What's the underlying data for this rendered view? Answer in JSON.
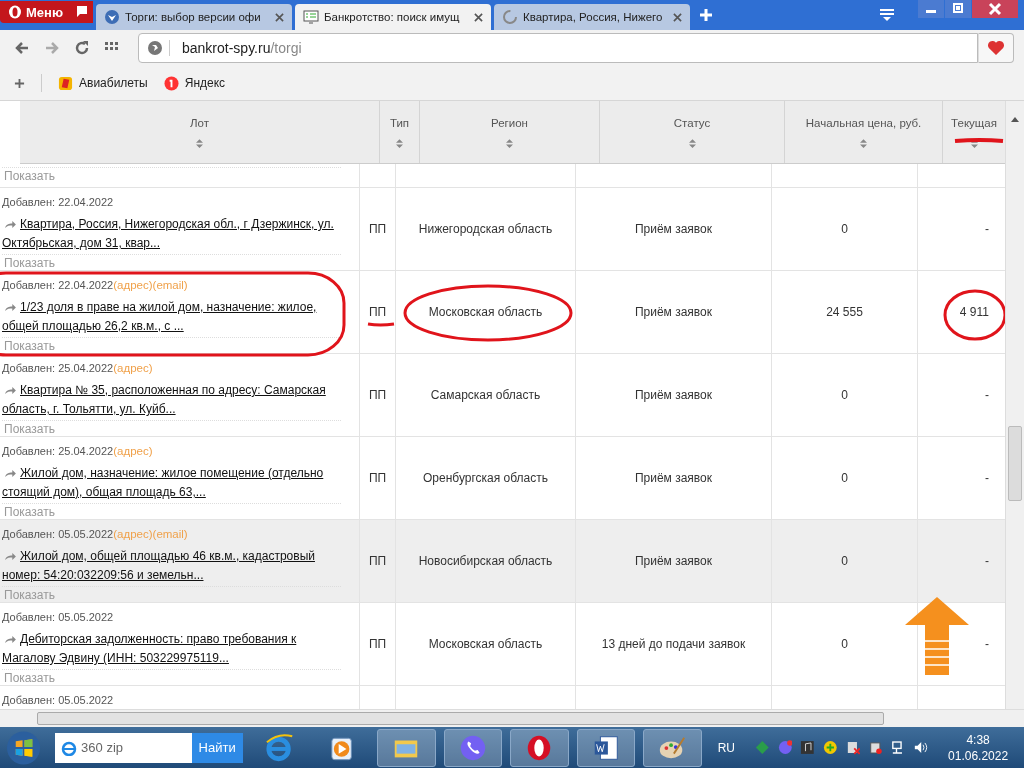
{
  "browser": {
    "menu_label": "Меню",
    "tabs": [
      {
        "title": "Торги: выбор версии офи",
        "selected": false,
        "loading": false
      },
      {
        "title": "Банкротство: поиск имущ",
        "selected": true,
        "loading": false
      },
      {
        "title": "Квартира, Россия, Нижего",
        "selected": false,
        "loading": true
      }
    ],
    "address": {
      "host": "bankrot-spy.ru",
      "path": "/torgi"
    },
    "bookmarks": [
      "Авиабилеты",
      "Яндекс"
    ]
  },
  "table": {
    "columns": [
      "Лот",
      "Тип",
      "Регион",
      "Статус",
      "Начальная цена, руб.",
      "Текущая"
    ],
    "partial_top_row": {
      "show_label": "Показать"
    },
    "rows": [
      {
        "added": "Добавлен: 22.04.2022",
        "tags": [],
        "title": "Квартира, Россия, Нижегородская обл., г Дзержинск, ул. Октябрьская, дом 31, квар...",
        "show_label": "Показать",
        "type": "ПП",
        "region": "Нижегородская область",
        "status": "Приём заявок",
        "start_price": "0",
        "current_price": "-",
        "hovered": false
      },
      {
        "added": "Добавлен: 22.04.2022",
        "tags": [
          "(адрес)",
          "(email)"
        ],
        "title": "1/23 доля в праве на жилой дом, назначение: жилое, общей площадью 26,2 кв.м., с ...",
        "show_label": "Показать",
        "type": "ПП",
        "region": "Московская область",
        "status": "Приём заявок",
        "start_price": "24 555",
        "current_price": "4 911",
        "hovered": false
      },
      {
        "added": "Добавлен: 25.04.2022",
        "tags": [
          "(адрес)"
        ],
        "title": "Квартира № 35, расположенная по адресу: Самарская область, г. Тольятти, ул. Куйб...",
        "show_label": "Показать",
        "type": "ПП",
        "region": "Самарская область",
        "status": "Приём заявок",
        "start_price": "0",
        "current_price": "-",
        "hovered": false
      },
      {
        "added": "Добавлен: 25.04.2022",
        "tags": [
          "(адрес)"
        ],
        "title": "Жилой дом, назначение: жилое помещение (отдельно стоящий дом), общая площадь 63,...",
        "show_label": "Показать",
        "type": "ПП",
        "region": "Оренбургская область",
        "status": "Приём заявок",
        "start_price": "0",
        "current_price": "-",
        "hovered": false
      },
      {
        "added": "Добавлен: 05.05.2022",
        "tags": [
          "(адрес)",
          "(email)"
        ],
        "title": "Жилой дом, общей площадью 46 кв.м., кадастровый номер: 54:20:032209:56 и земельн...",
        "show_label": "Показать",
        "type": "ПП",
        "region": "Новосибирская область",
        "status": "Приём заявок",
        "start_price": "0",
        "current_price": "-",
        "hovered": true
      },
      {
        "added": "Добавлен: 05.05.2022",
        "tags": [],
        "title": "Дебиторская задолженность: право требования к Магалову Эдвину (ИНН: 503229975119...",
        "show_label": "Показать",
        "type": "ПП",
        "region": "Московская область",
        "status": "13 дней до подачи заявок",
        "start_price": "0",
        "current_price": "-",
        "hovered": false
      }
    ],
    "partial_bottom_row": {
      "added": "Добавлен: 05.05.2022"
    }
  },
  "taskbar": {
    "search": {
      "value": "360 zip",
      "button": "Найти"
    },
    "language": "RU",
    "time": "4:38",
    "date": "01.06.2022"
  }
}
